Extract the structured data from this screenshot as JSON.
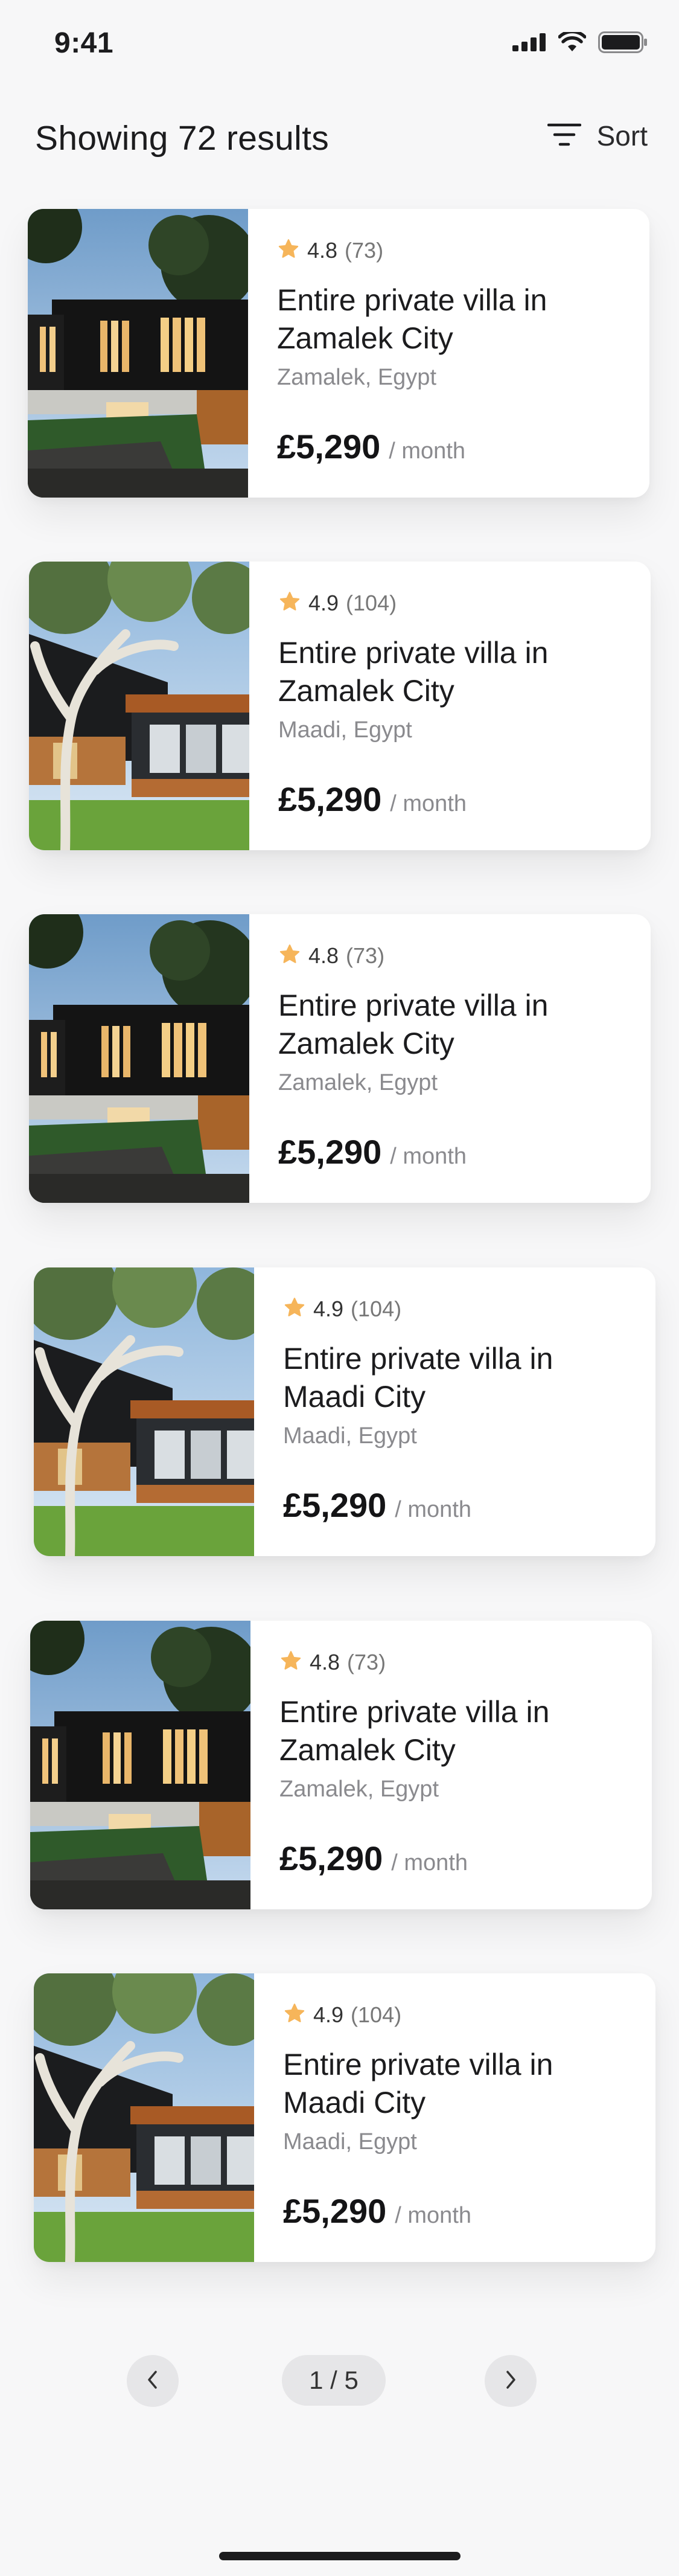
{
  "status_bar": {
    "time": "9:41",
    "icons": [
      "signal-icon",
      "wifi-icon",
      "battery-icon"
    ]
  },
  "header": {
    "title": "Showing 72 results",
    "sort_label": "Sort",
    "sort_icon": "sort-icon"
  },
  "listings": [
    {
      "rating": "4.8",
      "reviews": "(73)",
      "title": "Entire private villa in Zamalek City",
      "location": "Zamalek, Egypt",
      "price": "£5,290",
      "price_unit": "/ month",
      "photo": "dark-modern-villa"
    },
    {
      "rating": "4.9",
      "reviews": "(104)",
      "title": "Entire private villa in Zamalek City",
      "location": "Maadi, Egypt",
      "price": "£5,290",
      "price_unit": "/ month",
      "photo": "villa-with-eucalyptus"
    },
    {
      "rating": "4.8",
      "reviews": "(73)",
      "title": "Entire private villa in Zamalek City",
      "location": "Zamalek, Egypt",
      "price": "£5,290",
      "price_unit": "/ month",
      "photo": "dark-modern-villa"
    },
    {
      "rating": "4.9",
      "reviews": "(104)",
      "title": "Entire private villa in Maadi City",
      "location": "Maadi, Egypt",
      "price": "£5,290",
      "price_unit": "/ month",
      "photo": "villa-with-eucalyptus"
    },
    {
      "rating": "4.8",
      "reviews": "(73)",
      "title": "Entire private villa in Zamalek City",
      "location": "Zamalek, Egypt",
      "price": "£5,290",
      "price_unit": "/ month",
      "photo": "dark-modern-villa"
    },
    {
      "rating": "4.9",
      "reviews": "(104)",
      "title": "Entire private villa in Maadi City",
      "location": "Maadi, Egypt",
      "price": "£5,290",
      "price_unit": "/ month",
      "photo": "villa-with-eucalyptus"
    }
  ],
  "pagination": {
    "current": "1 / 5",
    "prev_icon": "chevron-left-icon",
    "next_icon": "chevron-right-icon"
  },
  "colors": {
    "star": "#f6b55a",
    "background": "#f7f7f8",
    "card": "#ffffff",
    "pill": "#e6e6e8"
  }
}
